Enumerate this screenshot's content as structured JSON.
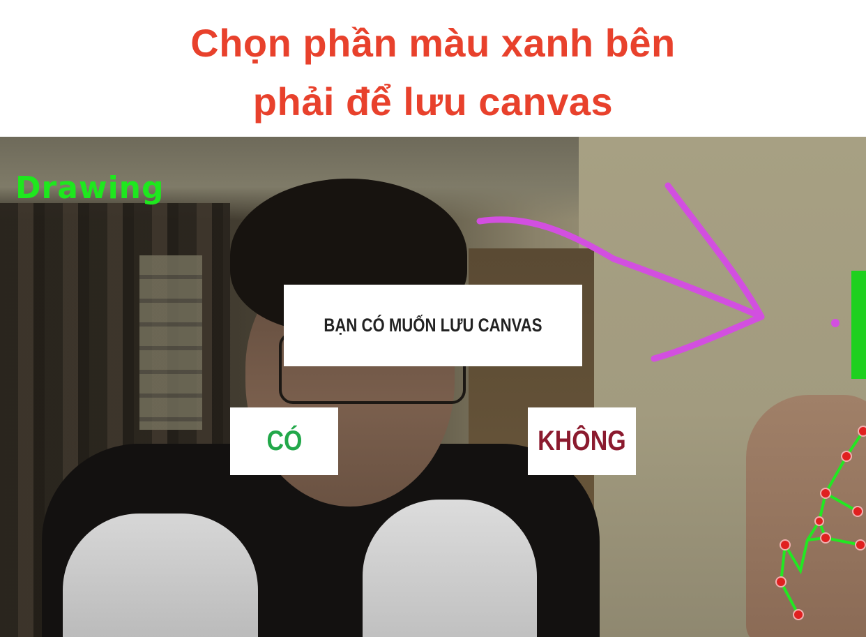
{
  "caption": {
    "line1": "Chọn phần màu xanh bên",
    "line2": "phải để lưu canvas"
  },
  "app": {
    "mode_label": "Drawing",
    "dialog": {
      "question": "BẠN CÓ MUỐN LƯU CANVAS",
      "yes_label": "CÓ",
      "no_label": "KHÔNG"
    }
  },
  "colors": {
    "caption_text": "#e8412c",
    "mode_label": "#1ee81e",
    "yes_label": "#22a84a",
    "no_label": "#8b1a2e",
    "save_bar": "#1fd01f",
    "drawing_stroke": "#d24fe0",
    "hand_skeleton": "#22e822",
    "hand_joint": "#e02020"
  },
  "icons": {
    "save_bar": "green-save-zone",
    "arrow": "hand-drawn-arrow"
  }
}
